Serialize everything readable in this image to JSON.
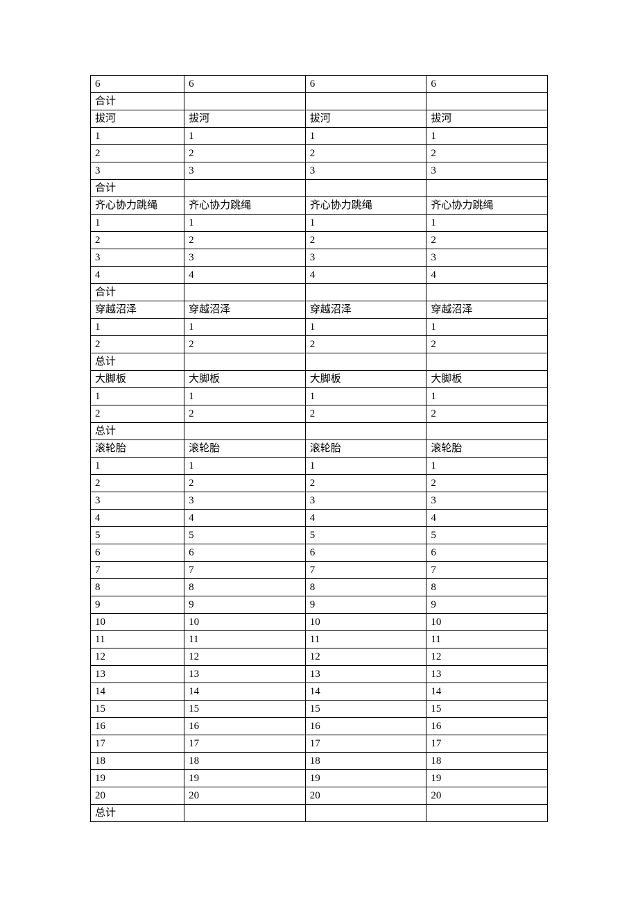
{
  "rows": [
    [
      "6",
      "6",
      "6",
      "6"
    ],
    [
      "合计",
      "",
      "",
      ""
    ],
    [
      "拔河",
      "拔河",
      "拔河",
      "拔河"
    ],
    [
      "1",
      "1",
      "1",
      "1"
    ],
    [
      "2",
      "2",
      "2",
      "2"
    ],
    [
      "3",
      "3",
      "3",
      "3"
    ],
    [
      "合计",
      "",
      "",
      ""
    ],
    [
      "齐心协力跳绳",
      "齐心协力跳绳",
      "齐心协力跳绳",
      "齐心协力跳绳"
    ],
    [
      "1",
      "1",
      "1",
      "1"
    ],
    [
      "2",
      "2",
      "2",
      "2"
    ],
    [
      "3",
      "3",
      "3",
      "3"
    ],
    [
      "4",
      "4",
      "4",
      "4"
    ],
    [
      "合计",
      "",
      "",
      ""
    ],
    [
      "穿越沼泽",
      "穿越沼泽",
      "穿越沼泽",
      "穿越沼泽"
    ],
    [
      "1",
      "1",
      "1",
      "1"
    ],
    [
      "2",
      "2",
      "2",
      "2"
    ],
    [
      "总计",
      "",
      "",
      ""
    ],
    [
      "大脚板",
      "大脚板",
      "大脚板",
      "大脚板"
    ],
    [
      "1",
      "1",
      "1",
      "1"
    ],
    [
      "2",
      "2",
      "2",
      "2"
    ],
    [
      "总计",
      "",
      "",
      ""
    ],
    [
      "滚轮胎",
      "滚轮胎",
      "滚轮胎",
      "滚轮胎"
    ],
    [
      "1",
      "1",
      "1",
      "1"
    ],
    [
      "2",
      "2",
      "2",
      "2"
    ],
    [
      "3",
      "3",
      "3",
      "3"
    ],
    [
      "4",
      "4",
      "4",
      "4"
    ],
    [
      "5",
      "5",
      "5",
      "5"
    ],
    [
      "6",
      "6",
      "6",
      "6"
    ],
    [
      "7",
      "7",
      "7",
      "7"
    ],
    [
      "8",
      "8",
      "8",
      "8"
    ],
    [
      "9",
      "9",
      "9",
      "9"
    ],
    [
      "10",
      "10",
      "10",
      "10"
    ],
    [
      "11",
      "11",
      "11",
      "11"
    ],
    [
      "12",
      "12",
      "12",
      "12"
    ],
    [
      "13",
      "13",
      "13",
      "13"
    ],
    [
      "14",
      "14",
      "14",
      "14"
    ],
    [
      "15",
      "15",
      "15",
      "15"
    ],
    [
      "16",
      "16",
      "16",
      "16"
    ],
    [
      "17",
      "17",
      "17",
      "17"
    ],
    [
      "18",
      "18",
      "18",
      "18"
    ],
    [
      "19",
      "19",
      "19",
      "19"
    ],
    [
      "20",
      "20",
      "20",
      "20"
    ],
    [
      "总计",
      "",
      "",
      ""
    ]
  ]
}
